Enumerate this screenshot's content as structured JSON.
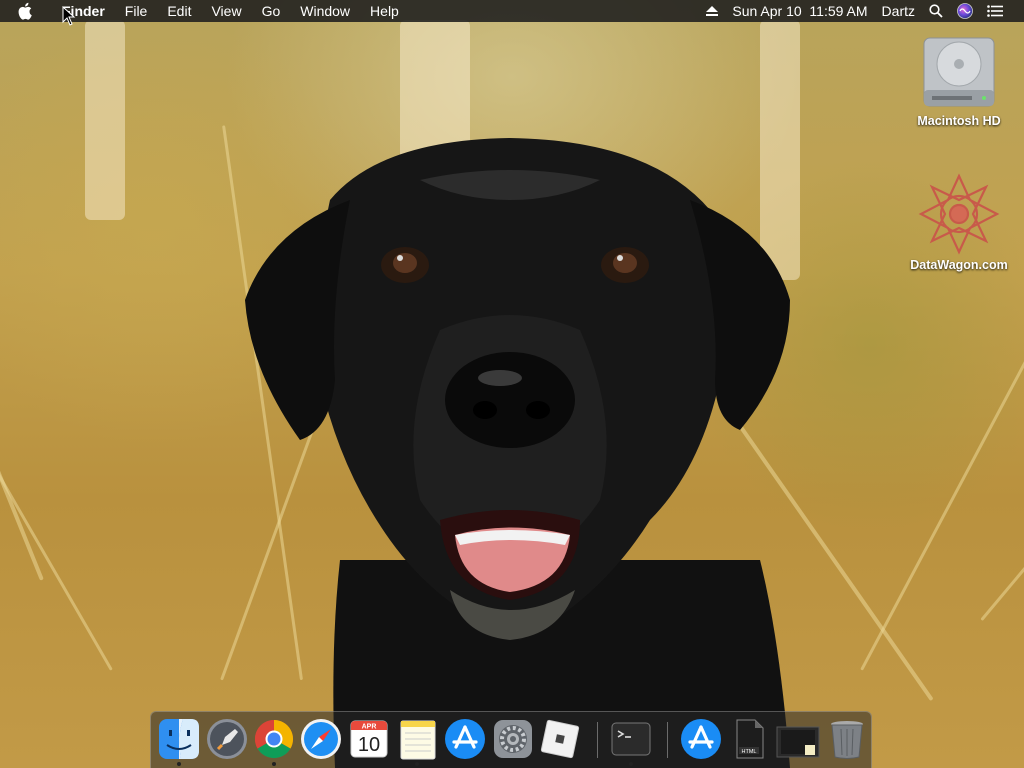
{
  "menubar": {
    "apple_icon": "apple-logo-icon",
    "items": [
      "Finder",
      "File",
      "Edit",
      "View",
      "Go",
      "Window",
      "Help"
    ],
    "status": {
      "eject_icon": "eject-icon",
      "datetime": "Sun Apr 10  11:59 AM",
      "user": "Dartz",
      "search_icon": "spotlight-search-icon",
      "siri_icon": "siri-icon",
      "notification_icon": "notification-center-icon"
    }
  },
  "desktop": {
    "icons": [
      {
        "label": "Macintosh HD",
        "icon": "hard-drive-icon"
      },
      {
        "label": "DataWagon.com",
        "icon": "datawagon-logo-icon"
      }
    ]
  },
  "dock": {
    "calendar_month": "APR",
    "calendar_day": "10",
    "apps": [
      {
        "icon": "finder-icon",
        "running": true
      },
      {
        "icon": "launchpad-icon",
        "running": false
      },
      {
        "icon": "chrome-icon",
        "running": true
      },
      {
        "icon": "safari-icon",
        "running": false
      },
      {
        "icon": "calendar-icon",
        "running": false
      },
      {
        "icon": "notes-icon",
        "running": true
      },
      {
        "icon": "app-store-icon",
        "running": false
      },
      {
        "icon": "system-preferences-icon",
        "running": false
      },
      {
        "icon": "roblox-icon",
        "running": false
      },
      {
        "icon": "terminal-icon",
        "running": true
      },
      {
        "icon": "app-store-download-icon",
        "running": false
      },
      {
        "icon": "html-file-icon",
        "running": false
      },
      {
        "icon": "folder-stack-icon",
        "running": false
      },
      {
        "icon": "trash-icon",
        "running": false
      }
    ]
  },
  "colors": {
    "menubar_bg": "#1e1e1e",
    "dock_bg": "#282828",
    "wallpaper_grass": "#c2a14e",
    "dog_fur": "#141414"
  }
}
